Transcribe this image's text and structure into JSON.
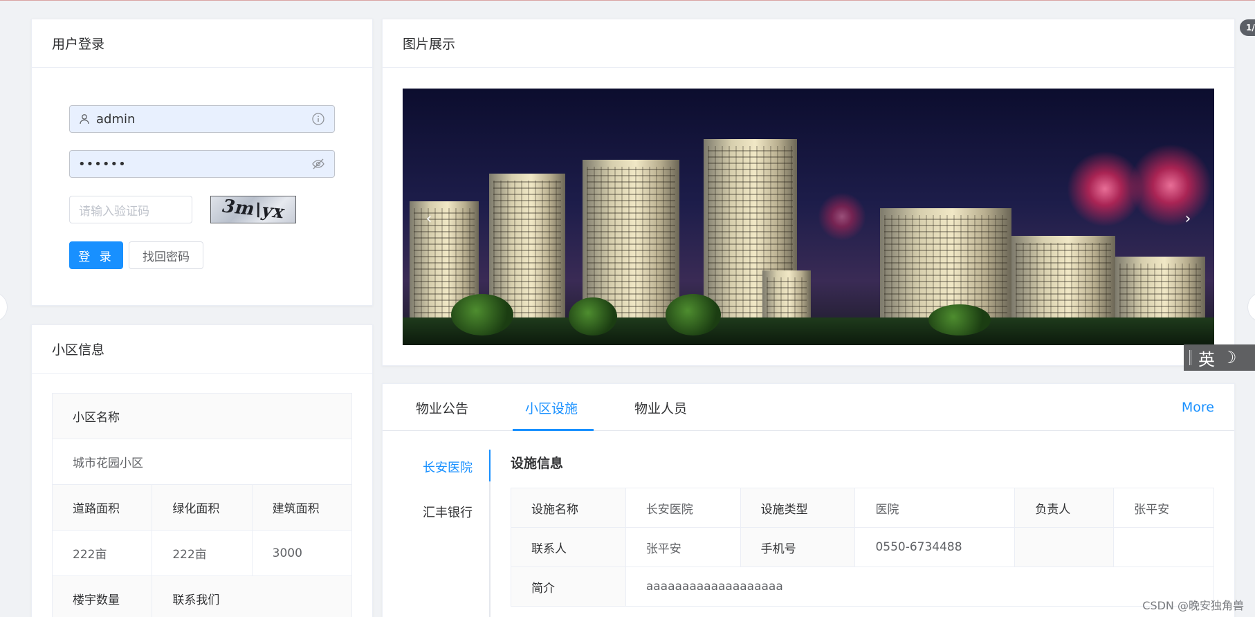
{
  "login": {
    "title": "用户登录",
    "username_value": "admin",
    "password_value": "••••••",
    "captcha_placeholder": "请输入验证码",
    "captcha_text": "3m\\yx",
    "login_label": "登 录",
    "forgot_label": "找回密码"
  },
  "community": {
    "title": "小区信息",
    "name_label": "小区名称",
    "name_value": "城市花园小区",
    "headers": [
      "道路面积",
      "绿化面积",
      "建筑面积"
    ],
    "values": [
      "222亩",
      "222亩",
      "3000"
    ],
    "building_count_label": "楼宇数量",
    "contact_label": "联系我们"
  },
  "gallery": {
    "title": "图片展示",
    "prev": "‹",
    "next": "›"
  },
  "tabs": {
    "items": [
      "物业公告",
      "小区设施",
      "物业人员"
    ],
    "active": 1,
    "more": "More"
  },
  "facility": {
    "side_items": [
      "长安医院",
      "汇丰银行"
    ],
    "title": "设施信息",
    "rows": [
      [
        "设施名称",
        "长安医院",
        "设施类型",
        "医院",
        "负责人",
        "张平安"
      ],
      [
        "联系人",
        "张平安",
        "手机号",
        "0550-6734488",
        "",
        ""
      ],
      [
        "简介",
        "aaaaaaaaaaaaaaaaaaa"
      ]
    ]
  },
  "ime": {
    "label": "英",
    "moon": "☽"
  },
  "pager": "1/",
  "watermark": "CSDN @晚安独角兽",
  "colors": {
    "primary": "#1890ff",
    "border": "#ebeef5",
    "label_bg": "#fafafa"
  }
}
